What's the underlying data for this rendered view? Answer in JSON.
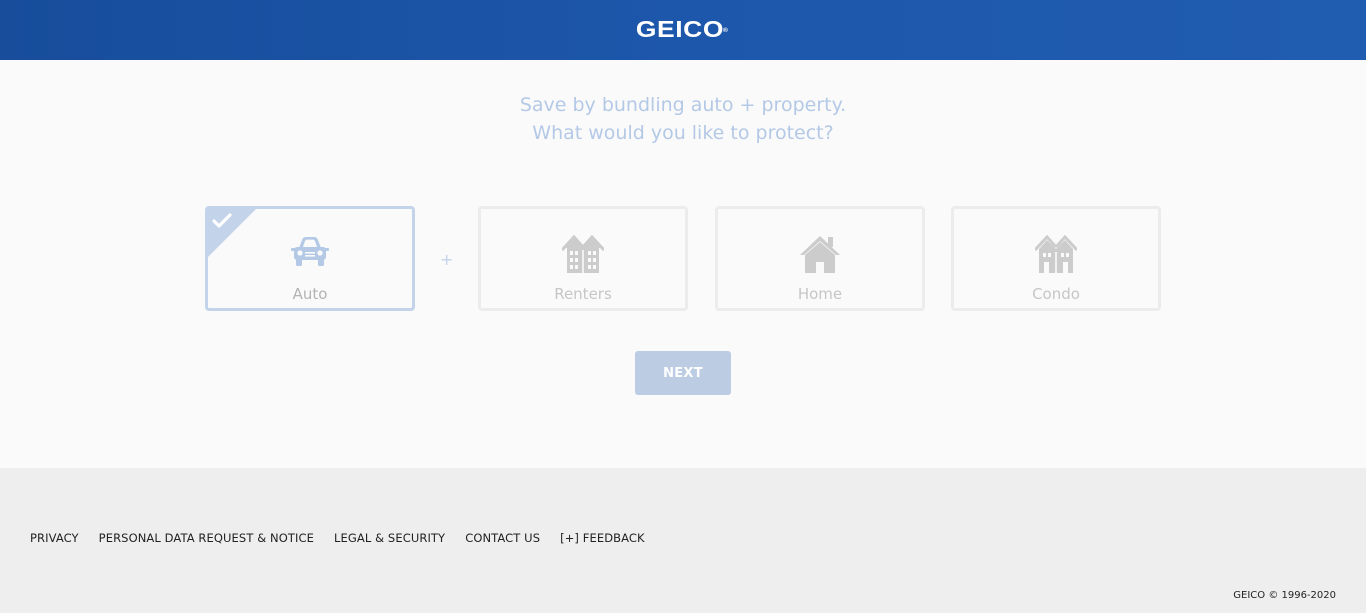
{
  "header": {
    "logo_text": "GEICO",
    "logo_mark": "®",
    "brand_color": "#1d57ab"
  },
  "main": {
    "headline_line1": "Save by bundling auto + property.",
    "headline_line2": "What would you like to protect?",
    "plus_sign": "+",
    "options": [
      {
        "label": "Auto",
        "icon": "car-icon",
        "selected": true
      },
      {
        "label": "Renters",
        "icon": "apartment-building-icon",
        "selected": false
      },
      {
        "label": "Home",
        "icon": "house-icon",
        "selected": false
      },
      {
        "label": "Condo",
        "icon": "condo-building-icon",
        "selected": false
      }
    ],
    "next_label": "NEXT"
  },
  "footer": {
    "links": [
      "PRIVACY",
      "PERSONAL DATA REQUEST & NOTICE",
      "LEGAL & SECURITY",
      "CONTACT US",
      "[+] FEEDBACK"
    ],
    "copyright": "GEICO © 1996-2020"
  },
  "colors": {
    "accent_light": "#c3d3ea",
    "footer_bg": "#eeeeee"
  }
}
